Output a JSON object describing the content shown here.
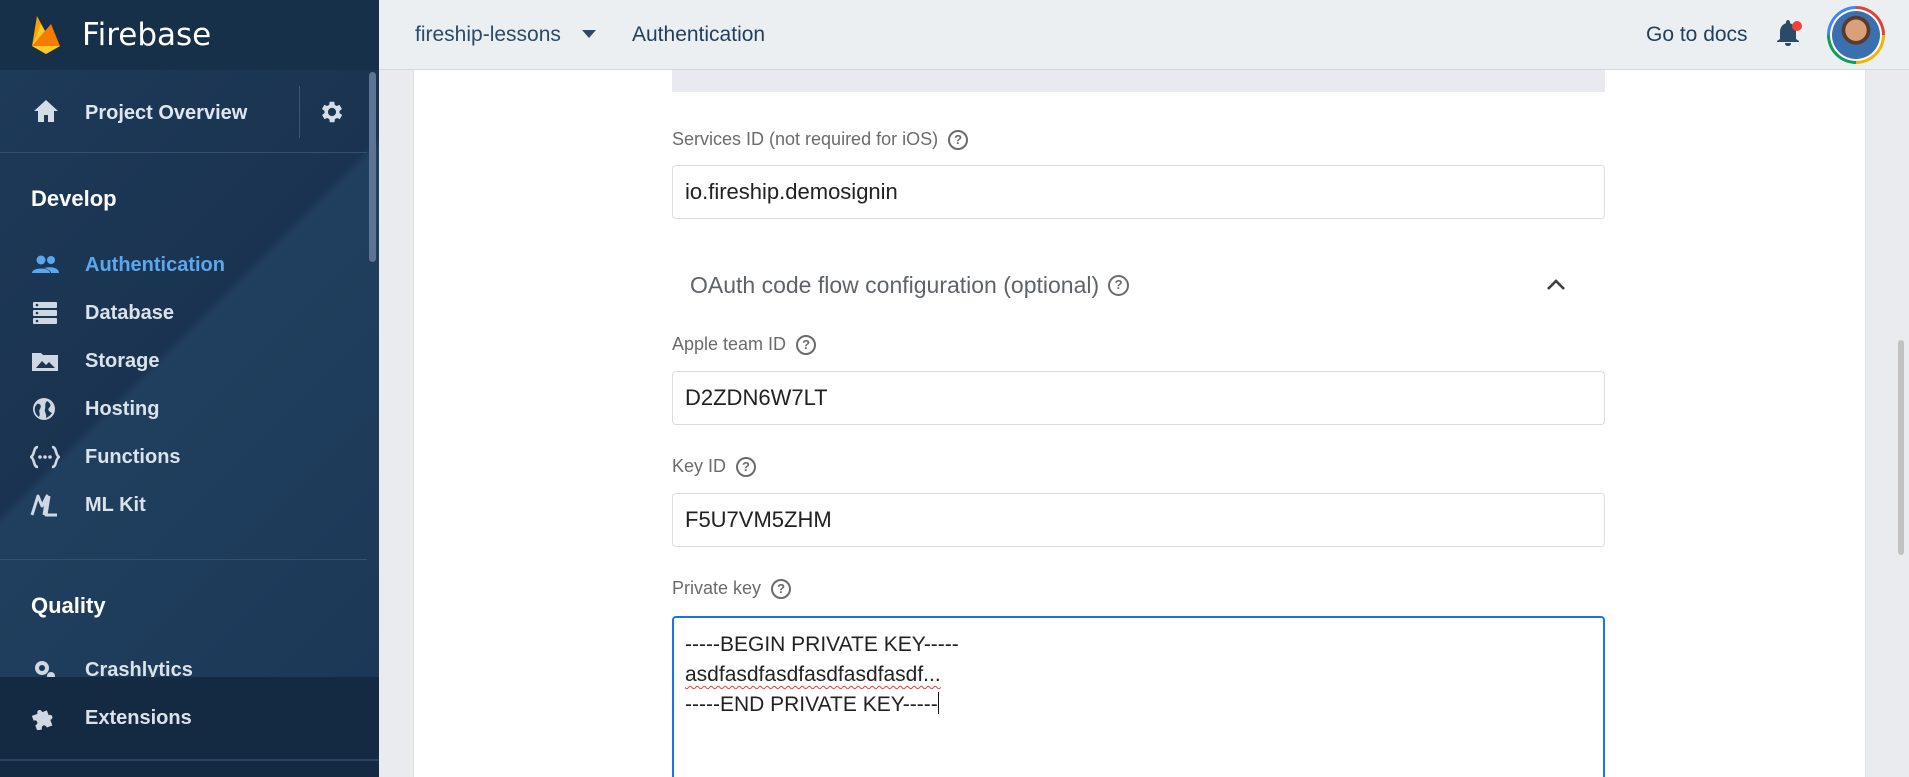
{
  "app": {
    "brand_name": "Firebase"
  },
  "topbar": {
    "project_name": "fireship-lessons",
    "breadcrumb": "Authentication",
    "docs_link": "Go to docs"
  },
  "sidebar": {
    "overview_label": "Project Overview",
    "develop_heading": "Develop",
    "items": [
      {
        "label": "Authentication",
        "icon": "people-icon",
        "active": true
      },
      {
        "label": "Database",
        "icon": "database-icon",
        "active": false
      },
      {
        "label": "Storage",
        "icon": "storage-icon",
        "active": false
      },
      {
        "label": "Hosting",
        "icon": "globe-icon",
        "active": false
      },
      {
        "label": "Functions",
        "icon": "functions-icon",
        "active": false
      },
      {
        "label": "ML Kit",
        "icon": "ml-kit-icon",
        "active": false
      }
    ],
    "quality_heading": "Quality",
    "crashlytics_label": "Crashlytics",
    "extensions_label": "Extensions"
  },
  "form": {
    "services_id": {
      "label": "Services ID (not required for iOS)",
      "value": "io.fireship.demosignin"
    },
    "oauth_section_title": "OAuth code flow configuration (optional)",
    "apple_team_id": {
      "label": "Apple team ID",
      "value": "D2ZDN6W7LT"
    },
    "key_id": {
      "label": "Key ID",
      "value": "F5U7VM5ZHM"
    },
    "private_key": {
      "label": "Private key",
      "line1": "-----BEGIN PRIVATE KEY-----",
      "line2": "asdfasdfasdfasdfasdfasdf...",
      "line3": "-----END PRIVATE KEY-----"
    }
  },
  "colors": {
    "sidebar_bg": "#1c3550",
    "active_nav": "#5aa8ee",
    "focus_border": "#1a73e8",
    "notification_dot": "#f44336"
  }
}
